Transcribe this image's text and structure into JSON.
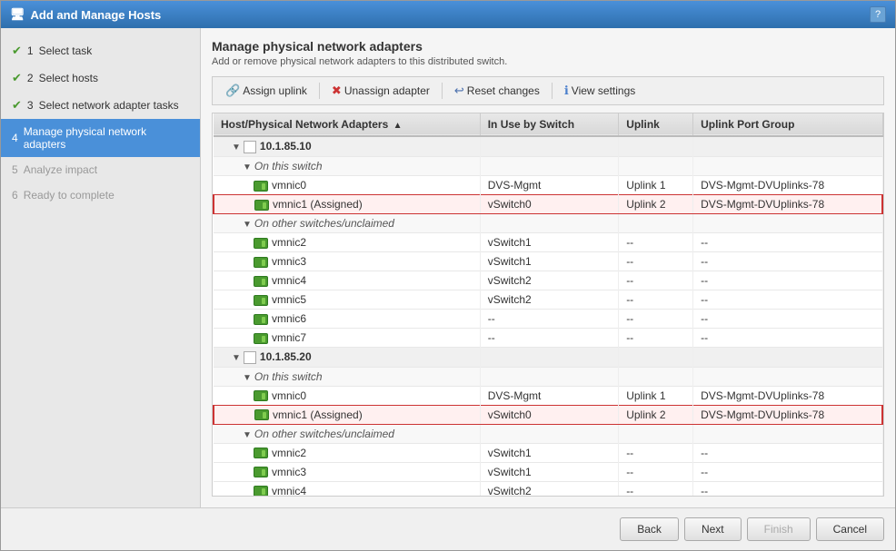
{
  "titleBar": {
    "title": "Add and Manage Hosts",
    "helpLabel": "?"
  },
  "sidebar": {
    "items": [
      {
        "id": "select-task",
        "num": "1",
        "label": "Select task",
        "state": "completed"
      },
      {
        "id": "select-hosts",
        "num": "2",
        "label": "Select hosts",
        "state": "completed"
      },
      {
        "id": "select-network-tasks",
        "num": "3",
        "label": "Select network adapter tasks",
        "state": "completed"
      },
      {
        "id": "manage-adapters",
        "num": "4",
        "label": "Manage physical network adapters",
        "state": "active"
      },
      {
        "id": "analyze-impact",
        "num": "5",
        "label": "Analyze impact",
        "state": "disabled"
      },
      {
        "id": "ready-to-complete",
        "num": "6",
        "label": "Ready to complete",
        "state": "disabled"
      }
    ]
  },
  "main": {
    "title": "Manage physical network adapters",
    "subtitle": "Add or remove physical network adapters to this distributed switch.",
    "toolbar": {
      "assignUplink": "Assign uplink",
      "unassignAdapter": "Unassign adapter",
      "resetChanges": "Reset changes",
      "viewSettings": "View settings"
    },
    "table": {
      "columns": [
        {
          "label": "Host/Physical Network Adapters",
          "sortable": true,
          "sortDir": "asc"
        },
        {
          "label": "In Use by Switch"
        },
        {
          "label": "Uplink"
        },
        {
          "label": "Uplink Port Group"
        }
      ],
      "rows": [
        {
          "type": "host",
          "indent": 1,
          "col1": "10.1.85.10",
          "col2": "",
          "col3": "",
          "col4": ""
        },
        {
          "type": "subgroup",
          "indent": 2,
          "col1": "On this switch",
          "col2": "",
          "col3": "",
          "col4": ""
        },
        {
          "type": "data",
          "indent": 3,
          "col1": "vmnic0",
          "col2": "DVS-Mgmt",
          "col3": "Uplink 1",
          "col4": "DVS-Mgmt-DVUplinks-78",
          "highlighted": false
        },
        {
          "type": "data",
          "indent": 3,
          "col1": "vmnic1 (Assigned)",
          "col2": "vSwitch0",
          "col3": "Uplink 2",
          "col4": "DVS-Mgmt-DVUplinks-78",
          "highlighted": true
        },
        {
          "type": "subgroup",
          "indent": 2,
          "col1": "On other switches/unclaimed",
          "col2": "",
          "col3": "",
          "col4": ""
        },
        {
          "type": "data",
          "indent": 3,
          "col1": "vmnic2",
          "col2": "vSwitch1",
          "col3": "--",
          "col4": "--",
          "highlighted": false
        },
        {
          "type": "data",
          "indent": 3,
          "col1": "vmnic3",
          "col2": "vSwitch1",
          "col3": "--",
          "col4": "--",
          "highlighted": false
        },
        {
          "type": "data",
          "indent": 3,
          "col1": "vmnic4",
          "col2": "vSwitch2",
          "col3": "--",
          "col4": "--",
          "highlighted": false
        },
        {
          "type": "data",
          "indent": 3,
          "col1": "vmnic5",
          "col2": "vSwitch2",
          "col3": "--",
          "col4": "--",
          "highlighted": false
        },
        {
          "type": "data",
          "indent": 3,
          "col1": "vmnic6",
          "col2": "--",
          "col3": "--",
          "col4": "--",
          "highlighted": false
        },
        {
          "type": "data",
          "indent": 3,
          "col1": "vmnic7",
          "col2": "--",
          "col3": "--",
          "col4": "--",
          "highlighted": false
        },
        {
          "type": "host",
          "indent": 1,
          "col1": "10.1.85.20",
          "col2": "",
          "col3": "",
          "col4": ""
        },
        {
          "type": "subgroup",
          "indent": 2,
          "col1": "On this switch",
          "col2": "",
          "col3": "",
          "col4": ""
        },
        {
          "type": "data",
          "indent": 3,
          "col1": "vmnic0",
          "col2": "DVS-Mgmt",
          "col3": "Uplink 1",
          "col4": "DVS-Mgmt-DVUplinks-78",
          "highlighted": false
        },
        {
          "type": "data",
          "indent": 3,
          "col1": "vmnic1 (Assigned)",
          "col2": "vSwitch0",
          "col3": "Uplink 2",
          "col4": "DVS-Mgmt-DVUplinks-78",
          "highlighted": true
        },
        {
          "type": "subgroup",
          "indent": 2,
          "col1": "On other switches/unclaimed",
          "col2": "",
          "col3": "",
          "col4": ""
        },
        {
          "type": "data",
          "indent": 3,
          "col1": "vmnic2",
          "col2": "vSwitch1",
          "col3": "--",
          "col4": "--",
          "highlighted": false
        },
        {
          "type": "data",
          "indent": 3,
          "col1": "vmnic3",
          "col2": "vSwitch1",
          "col3": "--",
          "col4": "--",
          "highlighted": false
        },
        {
          "type": "data",
          "indent": 3,
          "col1": "vmnic4",
          "col2": "vSwitch2",
          "col3": "--",
          "col4": "--",
          "highlighted": false
        }
      ]
    },
    "footer": {
      "back": "Back",
      "next": "Next",
      "finish": "Finish",
      "cancel": "Cancel"
    }
  }
}
